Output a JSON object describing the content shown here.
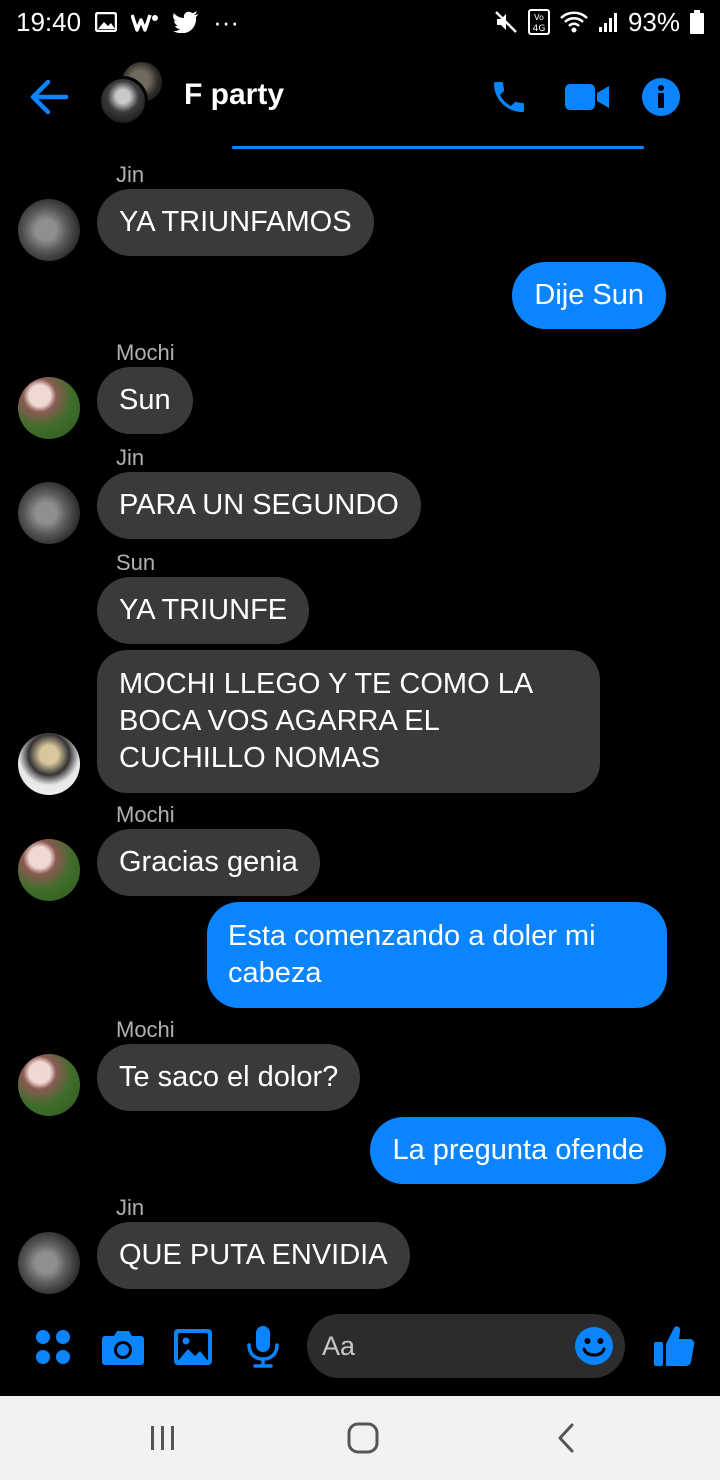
{
  "status_bar": {
    "time": "19:40",
    "more": "···",
    "network": "VoLTE 4G",
    "battery": "93%"
  },
  "header": {
    "title": "F party"
  },
  "colors": {
    "accent": "#0a84ff",
    "incoming_bubble": "#3a3a3c",
    "background": "#000000"
  },
  "messages": [
    {
      "sender": "Jin",
      "text": "YA TRIUNFAMOS",
      "direction": "in"
    },
    {
      "text": "Dije Sun",
      "direction": "out"
    },
    {
      "sender": "Mochi",
      "text": "Sun",
      "direction": "in"
    },
    {
      "sender": "Jin",
      "text": "PARA UN SEGUNDO",
      "direction": "in"
    },
    {
      "sender": "Sun",
      "text": "YA TRIUNFE",
      "direction": "in"
    },
    {
      "text": "MOCHI LLEGO Y TE COMO LA BOCA VOS AGARRA EL CUCHILLO NOMAS",
      "direction": "in"
    },
    {
      "sender": "Mochi",
      "text": "Gracias genia",
      "direction": "in"
    },
    {
      "text": "Esta comenzando a doler mi cabeza",
      "direction": "out"
    },
    {
      "sender": "Mochi",
      "text": "Te saco el dolor?",
      "direction": "in"
    },
    {
      "text": "La pregunta ofende",
      "direction": "out"
    },
    {
      "sender": "Jin",
      "text": "QUE PUTA ENVIDIA",
      "direction": "in"
    }
  ],
  "composer": {
    "placeholder": "Aa"
  },
  "icons": {
    "back": "arrow-left-icon",
    "call": "phone-icon",
    "video": "video-camera-icon",
    "info": "info-icon",
    "apps": "four-dots-icon",
    "camera": "camera-icon",
    "gallery": "image-icon",
    "mic": "microphone-icon",
    "emoji": "emoji-icon",
    "like": "thumbs-up-icon"
  }
}
